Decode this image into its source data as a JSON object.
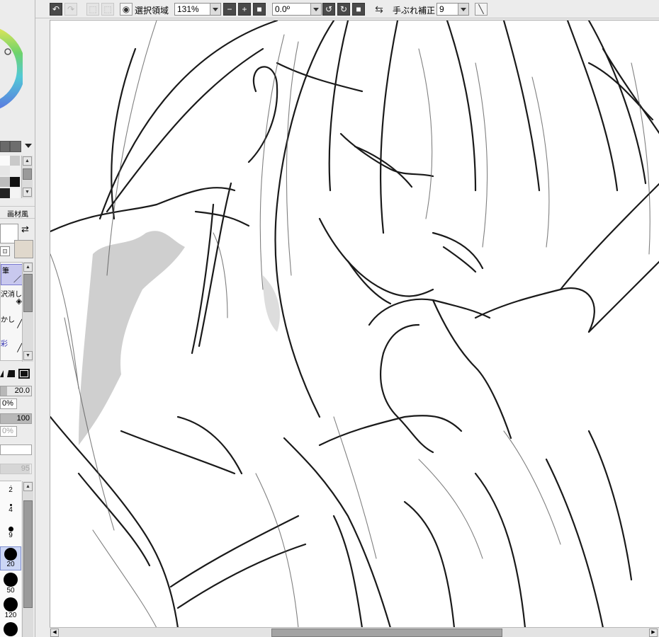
{
  "toolbar": {
    "selection_label": "選択領域",
    "zoom_value": "131%",
    "rotation_value": "0.0º",
    "stabilizer_label": "手ぶれ補正",
    "stabilizer_value": "9"
  },
  "left_panel": {
    "tab_label": "画材風",
    "tools": [
      {
        "label": "筆",
        "selected": true
      },
      {
        "label": "沢消し",
        "selected": false
      },
      {
        "label": "かし",
        "selected": false
      },
      {
        "label": "彩",
        "selected": false
      }
    ],
    "brush_size_value": "20.0",
    "min_size_value": "0%",
    "density_value": "100",
    "blend_value": "0%",
    "disabled_value": "95",
    "brush_sizes": [
      "2",
      "4",
      "9",
      "20",
      "50",
      "120"
    ],
    "selected_brush_size": "20"
  },
  "colors": {
    "canvas_bg": "#ffffff",
    "selection_highlight": "#c8c8ee",
    "toolbar_bg": "#ececec",
    "secondary_color": "#e0d8cc"
  }
}
